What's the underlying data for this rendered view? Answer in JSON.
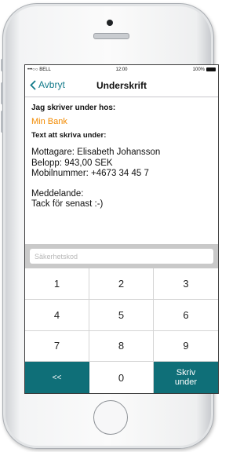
{
  "status_bar": {
    "carrier": "•••○○ BELL",
    "time": "12:00",
    "battery": "100%"
  },
  "nav": {
    "back_label": "Avbryt",
    "title": "Underskrift"
  },
  "content": {
    "signing_with_label": "Jag skriver under hos:",
    "bank_name": "Min Bank",
    "text_to_sign_label": "Text att skriva under:",
    "recipient": "Mottagare: Elisabeth Johansson",
    "amount": "Belopp: 943,00 SEK",
    "mobile": "Mobilnummer: +4673 34 45 7",
    "message_label": "Meddelande:",
    "message_text": "Tack för senast :-)"
  },
  "security_code": {
    "placeholder": "Säkerhetskod",
    "value": ""
  },
  "keypad": {
    "keys": [
      "1",
      "2",
      "3",
      "4",
      "5",
      "6",
      "7",
      "8",
      "9"
    ],
    "backspace_label": "<<",
    "zero_label": "0",
    "sign_label_line1": "Skriv",
    "sign_label_line2": "under"
  },
  "colors": {
    "accent": "#127a8a",
    "bank": "#f28a00",
    "keypad_action": "#0f6f78"
  }
}
